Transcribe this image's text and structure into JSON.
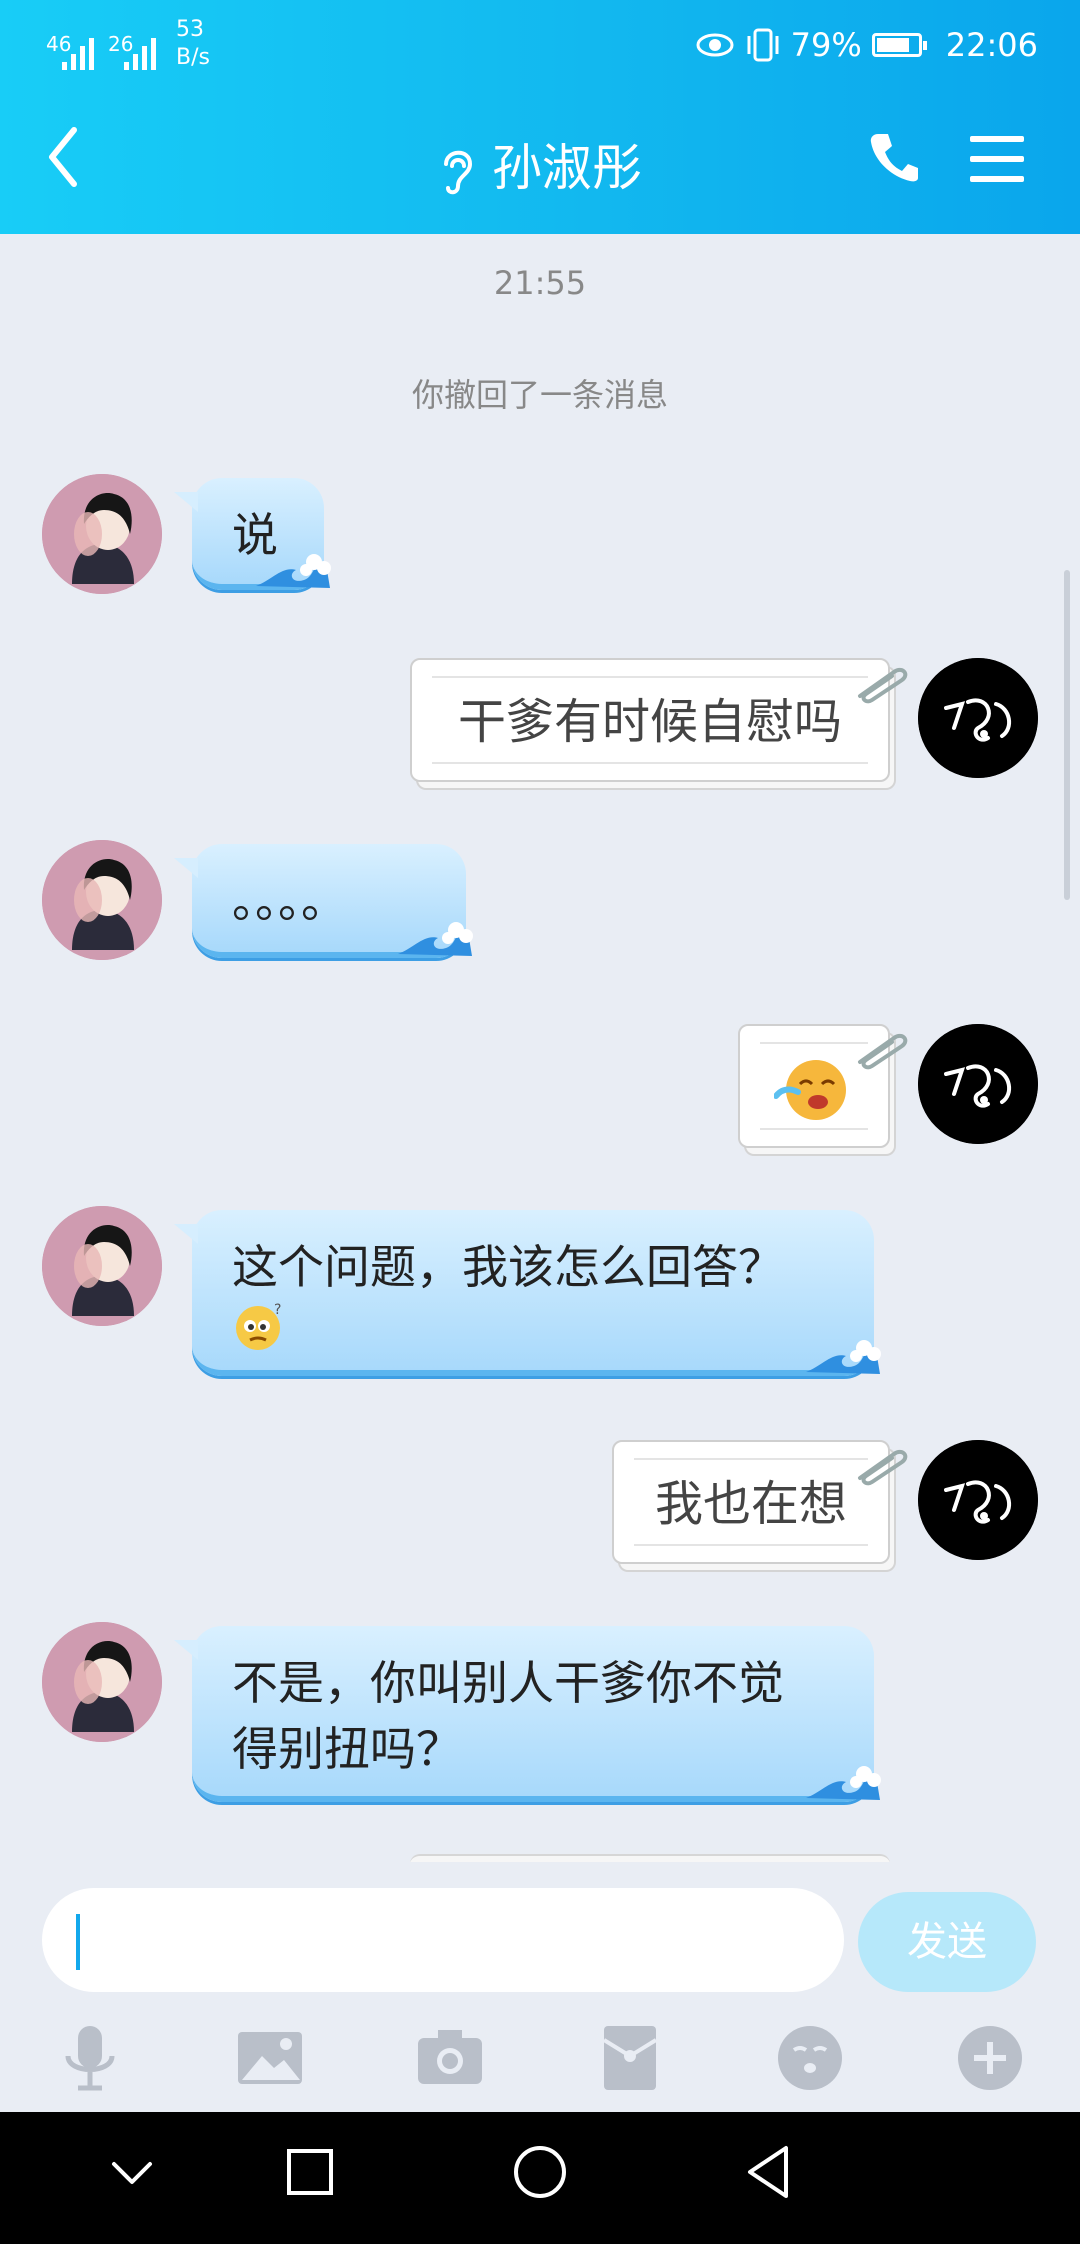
{
  "status_bar": {
    "signal1": "46",
    "signal2": "26",
    "net_speed_value": "53",
    "net_speed_unit": "B/s",
    "battery_text": "79%",
    "time": "22:06",
    "battery_level": 0.79
  },
  "header": {
    "contact_name": "孙淑彤"
  },
  "chat": {
    "timestamp": "21:55",
    "recall_notice": "你撤回了一条消息",
    "messages": [
      {
        "side": "in",
        "text": "说"
      },
      {
        "side": "out",
        "text": "干爹有时候自慰吗"
      },
      {
        "side": "in",
        "text": "。。。。"
      },
      {
        "side": "out",
        "text": "",
        "sticker": "tearful-laughing-emoji"
      },
      {
        "side": "in",
        "text": "这个问题，我该怎么回答？",
        "sticker": "confused-emoji"
      },
      {
        "side": "out",
        "text": "我也在想"
      },
      {
        "side": "in",
        "line1": "不是，你叫别人干爹你不觉",
        "line2": "得别扭吗？"
      }
    ]
  },
  "composer": {
    "input_value": "",
    "send_label": "发送"
  },
  "toolbar": [
    "mic-icon",
    "image-icon",
    "camera-icon",
    "red-packet-icon",
    "emoji-icon",
    "plus-icon"
  ],
  "colors": {
    "header_start": "#18cdf7",
    "header_end": "#0aa6ec",
    "chat_bg": "#e9edf4",
    "send_button": "#b6e8fa"
  }
}
